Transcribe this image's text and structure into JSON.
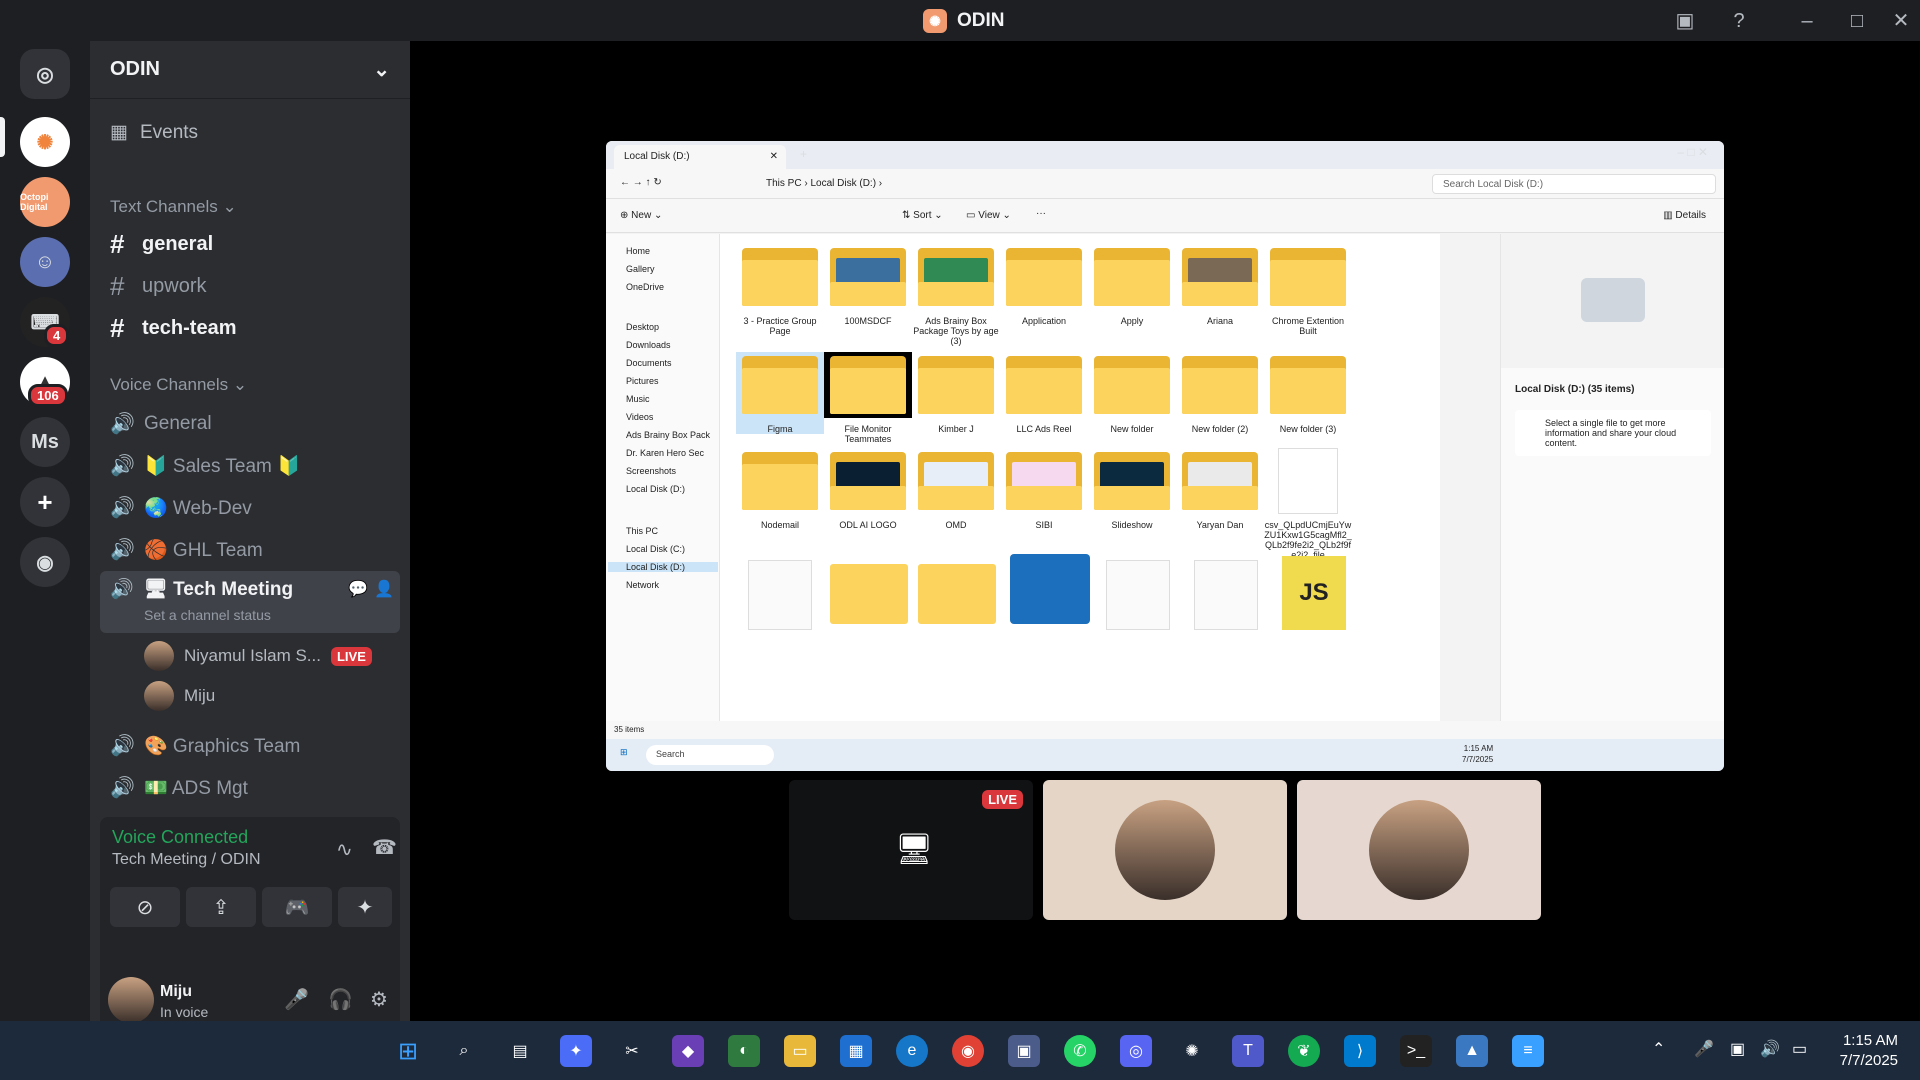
{
  "window": {
    "title": "ODIN"
  },
  "servers": {
    "badge_tech": "4",
    "badge_other": "106",
    "ms_label": "Ms",
    "octopi_label": "Octopi Digital"
  },
  "sidebar": {
    "server_name": "ODIN",
    "events_label": "Events",
    "text_category": "Text Channels",
    "text_channels": [
      "general",
      "upwork",
      "tech-team"
    ],
    "voice_category": "Voice Channels",
    "voice_channels": {
      "general": "General",
      "sales": "🔰 Sales Team 🔰",
      "webdev": "🌏 Web-Dev",
      "ghl": "🏀 GHL Team",
      "tech": "🖥 Tech Meeting",
      "graphics": "🎨 Graphics Team",
      "ads": "💵 ADS Mgt"
    },
    "channel_status": "Set a channel status",
    "voice_users": [
      {
        "name": "Niyamul Islam S...",
        "live": "LIVE"
      },
      {
        "name": "Miju"
      }
    ]
  },
  "voice_panel": {
    "status": "Voice Connected",
    "location": "Tech Meeting / ODIN"
  },
  "user": {
    "name": "Miju",
    "status": "In voice"
  },
  "explorer": {
    "tab_title": "Local Disk (D:)",
    "breadcrumb": [
      "This PC",
      "Local Disk (D:)"
    ],
    "search_placeholder": "Search Local Disk (D:)",
    "commands": {
      "new": "New",
      "sort": "Sort",
      "view": "View",
      "details": "Details"
    },
    "nav": [
      "Home",
      "Gallery",
      "OneDrive",
      "Desktop",
      "Downloads",
      "Documents",
      "Pictures",
      "Music",
      "Videos",
      "Ads Brainy Box Pack",
      "Dr. Karen Hero Sec",
      "Screenshots",
      "Local Disk (D:)",
      "This PC",
      "Local Disk (C:)",
      "Local Disk (D:)",
      "Network"
    ],
    "files": [
      "3 - Practice Group Page",
      "100MSDCF",
      "Ads Brainy Box Package Toys by age (3)",
      "Application",
      "Apply",
      "Ariana",
      "Chrome Extention Built",
      "Figma",
      "File Monitor Teammates",
      "Kimber J",
      "LLC Ads Reel",
      "New folder",
      "New folder (2)",
      "New folder (3)",
      "Nodemail",
      "ODL AI LOGO",
      "OMD",
      "SIBI",
      "Slideshow",
      "Yaryan Dan",
      "csv_QLpdUCmjEuYwZU1Kxw1G5cagMfl2_QLb2f9fe2i2_QLb2f9fe2i2_file"
    ],
    "details_title": "Local Disk (D:) (35 items)",
    "details_info": "Select a single file to get more information and share your cloud content.",
    "status": "35 items",
    "taskbar_search": "Search",
    "taskbar_time": "1:15 AM",
    "taskbar_date": "7/7/2025"
  },
  "tiles": {
    "live_label": "LIVE"
  },
  "taskbar": {
    "time": "1:15 AM",
    "date": "7/7/2025"
  }
}
